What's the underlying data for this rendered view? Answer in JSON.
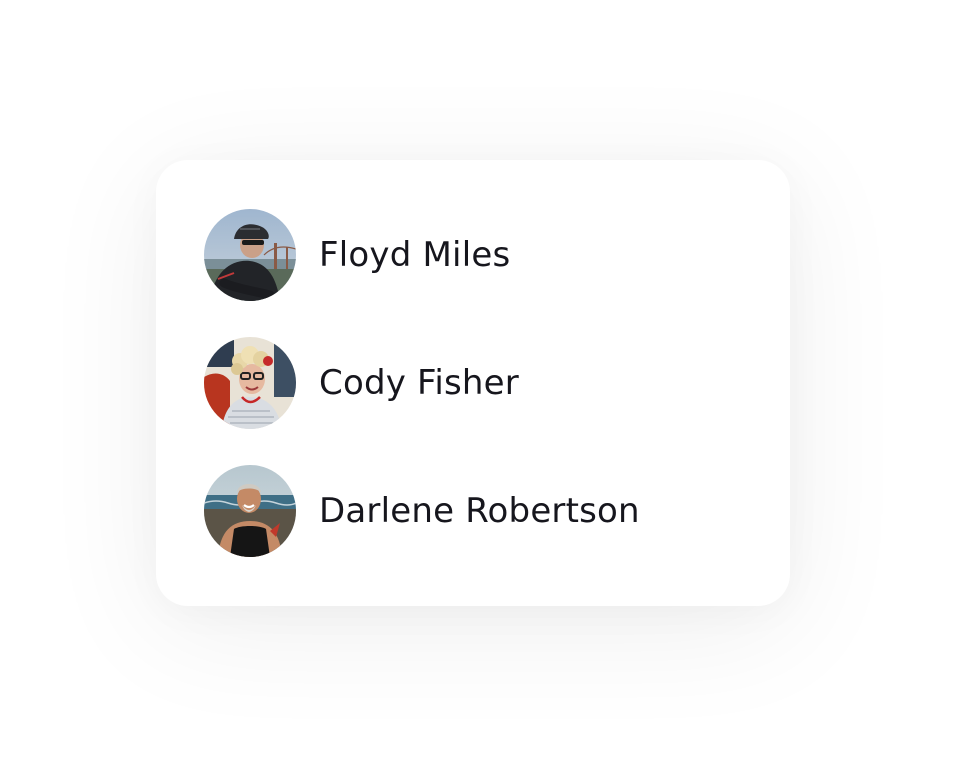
{
  "people": [
    {
      "name": "Floyd Miles"
    },
    {
      "name": "Cody Fisher"
    },
    {
      "name": "Darlene Robertson"
    }
  ]
}
